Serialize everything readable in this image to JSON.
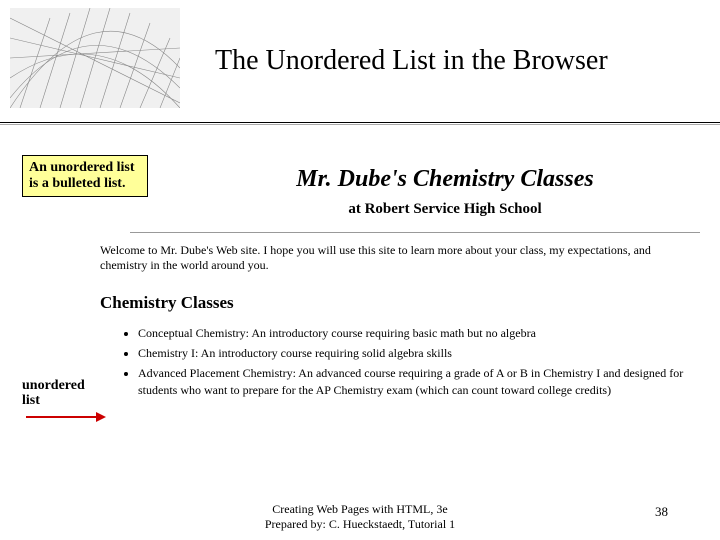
{
  "slide": {
    "title": "The Unordered List in the Browser"
  },
  "callout": {
    "text": "An unordered list is a bulleted list."
  },
  "arrow_label": "unordered list",
  "web": {
    "heading": "Mr. Dube's Chemistry Classes",
    "subheading": "at Robert Service High School",
    "welcome": "Welcome to Mr. Dube's Web site. I hope you will use this site to learn more about your class, my expectations, and chemistry in the world around you.",
    "section_title": "Chemistry Classes",
    "list": [
      "Conceptual Chemistry: An introductory course requiring basic math but no algebra",
      "Chemistry I: An introductory course requiring solid algebra skills",
      "Advanced Placement Chemistry: An advanced course requiring a grade of A or B in Chemistry I and designed for students who want to prepare for the AP Chemistry exam (which can count toward college credits)"
    ]
  },
  "footer": {
    "line1": "Creating Web Pages with HTML, 3e",
    "line2": "Prepared by: C. Hueckstaedt, Tutorial 1",
    "page": "38"
  }
}
